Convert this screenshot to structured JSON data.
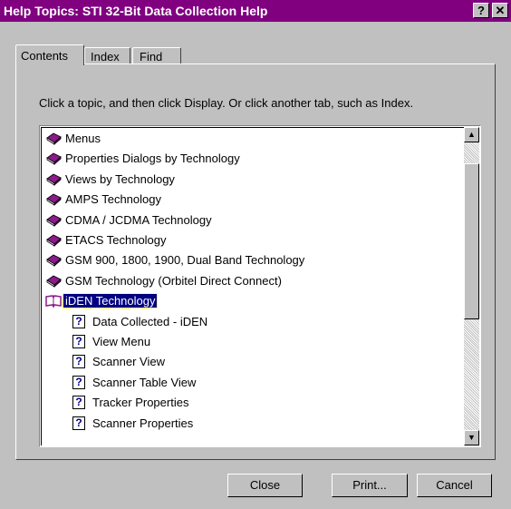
{
  "window": {
    "title": "Help Topics: STI 32-Bit Data Collection Help",
    "help_btn": "?",
    "close_btn": "✕"
  },
  "tabs": [
    {
      "label": "Contents"
    },
    {
      "label": "Index"
    },
    {
      "label": "Find"
    }
  ],
  "instruction": "Click a topic, and then click Display. Or click another tab, such as Index.",
  "topics": [
    {
      "label": "Menus",
      "icon": "closed-book-icon"
    },
    {
      "label": "Properties Dialogs by Technology",
      "icon": "closed-book-icon"
    },
    {
      "label": "Views by Technology",
      "icon": "closed-book-icon"
    },
    {
      "label": "AMPS Technology",
      "icon": "closed-book-icon"
    },
    {
      "label": "CDMA / JCDMA Technology",
      "icon": "closed-book-icon"
    },
    {
      "label": "ETACS Technology",
      "icon": "closed-book-icon"
    },
    {
      "label": "GSM 900, 1800, 1900, Dual Band Technology",
      "icon": "closed-book-icon"
    },
    {
      "label": "GSM Technology (Orbitel Direct Connect)",
      "icon": "closed-book-icon"
    },
    {
      "label": "iDEN Technology",
      "icon": "open-book-icon",
      "selected": true
    },
    {
      "label": "Data Collected - iDEN",
      "icon": "help-page-icon"
    },
    {
      "label": "View Menu",
      "icon": "help-page-icon"
    },
    {
      "label": "Scanner View",
      "icon": "help-page-icon"
    },
    {
      "label": "Scanner Table View",
      "icon": "help-page-icon"
    },
    {
      "label": "Tracker Properties",
      "icon": "help-page-icon"
    },
    {
      "label": "Scanner Properties",
      "icon": "help-page-icon"
    }
  ],
  "help_page_glyph": "?",
  "buttons": {
    "close": "Close",
    "print": "Print...",
    "cancel": "Cancel"
  },
  "colors": {
    "titlebar": "#800080",
    "selection": "#000080",
    "book": "#8b1a8b"
  }
}
